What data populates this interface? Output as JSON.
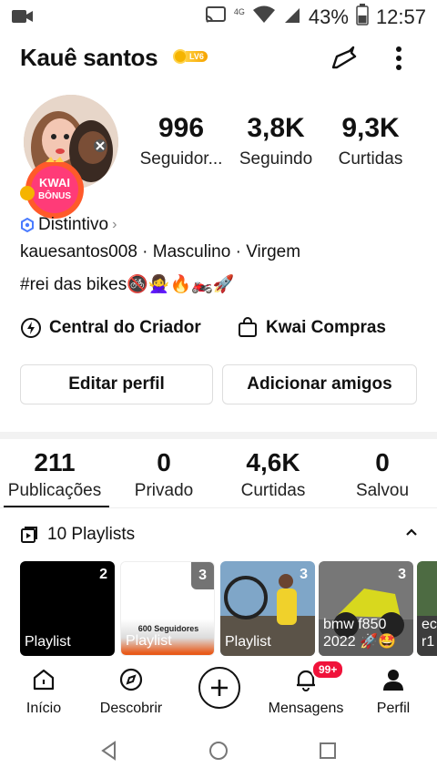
{
  "status_bar": {
    "network": "4G",
    "battery": "43%",
    "time": "12:57"
  },
  "profile": {
    "name": "Kauê santos",
    "level_badge": "LV6",
    "bonus_badge_line1": "KWAI",
    "bonus_badge_line2": "BÔNUS",
    "stats": [
      {
        "value": "996",
        "label": "Seguidor..."
      },
      {
        "value": "3,8K",
        "label": "Seguindo"
      },
      {
        "value": "9,3K",
        "label": "Curtidas"
      }
    ],
    "distintivo": "Distintivo",
    "meta": "kauesantos008 · Masculino · Virgem",
    "bio": "#rei das bikes🚳🙅‍♀️🔥🏍️🚀"
  },
  "links": {
    "creator": "Central do Criador",
    "shop": "Kwai Compras"
  },
  "buttons": {
    "edit": "Editar perfil",
    "add_friends": "Adicionar amigos"
  },
  "tabs": [
    {
      "value": "211",
      "label": "Publicações"
    },
    {
      "value": "0",
      "label": "Privado"
    },
    {
      "value": "4,6K",
      "label": "Curtidas"
    },
    {
      "value": "0",
      "label": "Salvou"
    }
  ],
  "playlists": {
    "header": "10 Playlists",
    "items": [
      {
        "count": "2",
        "title": "Playlist",
        "overlay": ""
      },
      {
        "count": "3",
        "title": "Playlist",
        "overlay": "600 Seguidores"
      },
      {
        "count": "3",
        "title": "Playlist",
        "overlay": ""
      },
      {
        "count": "3",
        "title": "bmw f850 2022 🚀🤩",
        "overlay": ""
      },
      {
        "count": "",
        "title": "ec r1",
        "overlay": ""
      }
    ]
  },
  "bottom_nav": {
    "home": "Início",
    "discover": "Descobrir",
    "messages": "Mensagens",
    "messages_badge": "99+",
    "profile": "Perfil"
  },
  "colors": {
    "accent_red": "#f0123a",
    "level_gold": "#f6a300",
    "verify_blue": "#4a7bff"
  }
}
